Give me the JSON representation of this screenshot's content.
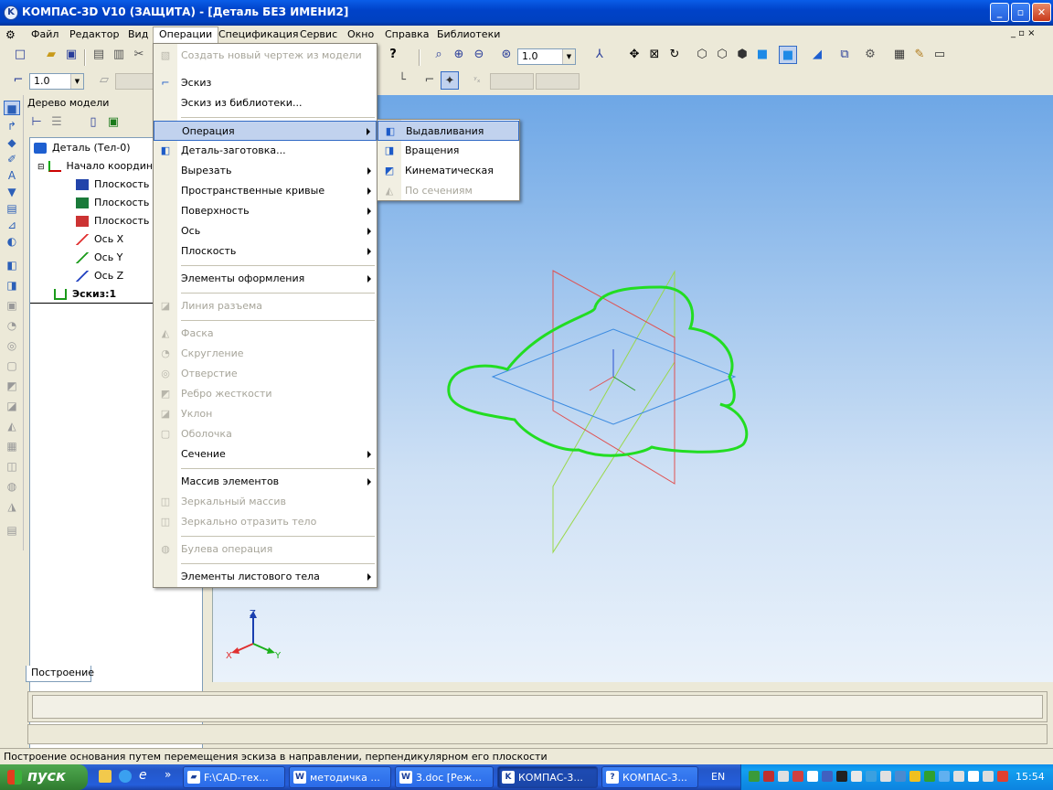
{
  "window": {
    "title": "КОМПАС-3D V10 (ЗАЩИТА) - [Деталь БЕЗ ИМЕНИ2]",
    "doc_controls": "_ ▫ ×"
  },
  "menubar": {
    "items": [
      "Файл",
      "Редактор",
      "Вид",
      "Операции",
      "Спецификация",
      "Сервис",
      "Окно",
      "Справка",
      "Библиотеки"
    ]
  },
  "toolbar": {
    "zoom_value": "1.0",
    "step_value": "1.0"
  },
  "tree": {
    "header": "Дерево модели",
    "nodes": [
      "Деталь (Тел-0)",
      "Начало координ",
      "Плоскость X",
      "Плоскость Z",
      "Плоскость Z",
      "Ось X",
      "Ось Y",
      "Ось Z",
      "Эскиз:1"
    ],
    "tab": "Построение"
  },
  "operations_menu": {
    "items": [
      {
        "label": "Создать новый чертеж из модели",
        "enabled": false,
        "icon": "drawing-from-model-icon"
      },
      {
        "label": "Эскиз",
        "enabled": true,
        "icon": "sketch-icon"
      },
      {
        "label": "Эскиз из библиотеки...",
        "enabled": true,
        "icon": ""
      },
      {
        "label": "Операция",
        "enabled": true,
        "icon": "",
        "submenu": true,
        "highlighted": true
      },
      {
        "label": "Деталь-заготовка...",
        "enabled": true,
        "icon": "blank-part-icon"
      },
      {
        "label": "Вырезать",
        "enabled": true,
        "icon": "",
        "submenu": true
      },
      {
        "label": "Пространственные кривые",
        "enabled": true,
        "icon": "",
        "submenu": true
      },
      {
        "label": "Поверхность",
        "enabled": true,
        "icon": "",
        "submenu": true
      },
      {
        "label": "Ось",
        "enabled": true,
        "icon": "",
        "submenu": true
      },
      {
        "label": "Плоскость",
        "enabled": true,
        "icon": "",
        "submenu": true
      },
      {
        "label": "Элементы оформления",
        "enabled": true,
        "icon": "",
        "submenu": true
      },
      {
        "label": "Линия разъема",
        "enabled": false,
        "icon": "parting-line-icon"
      },
      {
        "label": "Фаска",
        "enabled": false,
        "icon": "chamfer-icon"
      },
      {
        "label": "Скругление",
        "enabled": false,
        "icon": "fillet-icon"
      },
      {
        "label": "Отверстие",
        "enabled": false,
        "icon": "hole-icon"
      },
      {
        "label": "Ребро жесткости",
        "enabled": false,
        "icon": "rib-icon"
      },
      {
        "label": "Уклон",
        "enabled": false,
        "icon": "draft-icon"
      },
      {
        "label": "Оболочка",
        "enabled": false,
        "icon": "shell-icon"
      },
      {
        "label": "Сечение",
        "enabled": true,
        "icon": "",
        "submenu": true
      },
      {
        "label": "Массив элементов",
        "enabled": true,
        "icon": "",
        "submenu": true
      },
      {
        "label": "Зеркальный массив",
        "enabled": false,
        "icon": "mirror-array-icon"
      },
      {
        "label": "Зеркально отразить тело",
        "enabled": false,
        "icon": "mirror-body-icon"
      },
      {
        "label": "Булева операция",
        "enabled": false,
        "icon": "boolean-icon"
      },
      {
        "label": "Элементы листового тела",
        "enabled": true,
        "icon": "",
        "submenu": true
      }
    ]
  },
  "operation_submenu": {
    "items": [
      {
        "label": "Выдавливания",
        "enabled": true,
        "highlighted": true,
        "icon": "extrude-icon"
      },
      {
        "label": "Вращения",
        "enabled": true,
        "icon": "revolve-icon"
      },
      {
        "label": "Кинематическая",
        "enabled": true,
        "icon": "sweep-icon"
      },
      {
        "label": "По сечениям",
        "enabled": false,
        "icon": "loft-icon"
      }
    ]
  },
  "axes_triad": {
    "x": "X",
    "y": "Y",
    "z": "Z"
  },
  "status_bar": "Построение основания путем перемещения эскиза в направлении, перпендикулярном его плоскости",
  "taskbar": {
    "start_label": "пуск",
    "tasks": [
      "F:\\CAD-тех...",
      "методичка ...",
      "3.doc [Реж...",
      "КОМПАС-3...",
      "КОМПАС-3..."
    ],
    "language": "EN",
    "clock": "15:54"
  },
  "colors": {
    "sketch_contour": "#22dd22",
    "plane_xy": "#3a8ae0",
    "plane_red": "#e05050",
    "plane_green": "#9ad84a",
    "highlight": "#c1d2ee"
  }
}
